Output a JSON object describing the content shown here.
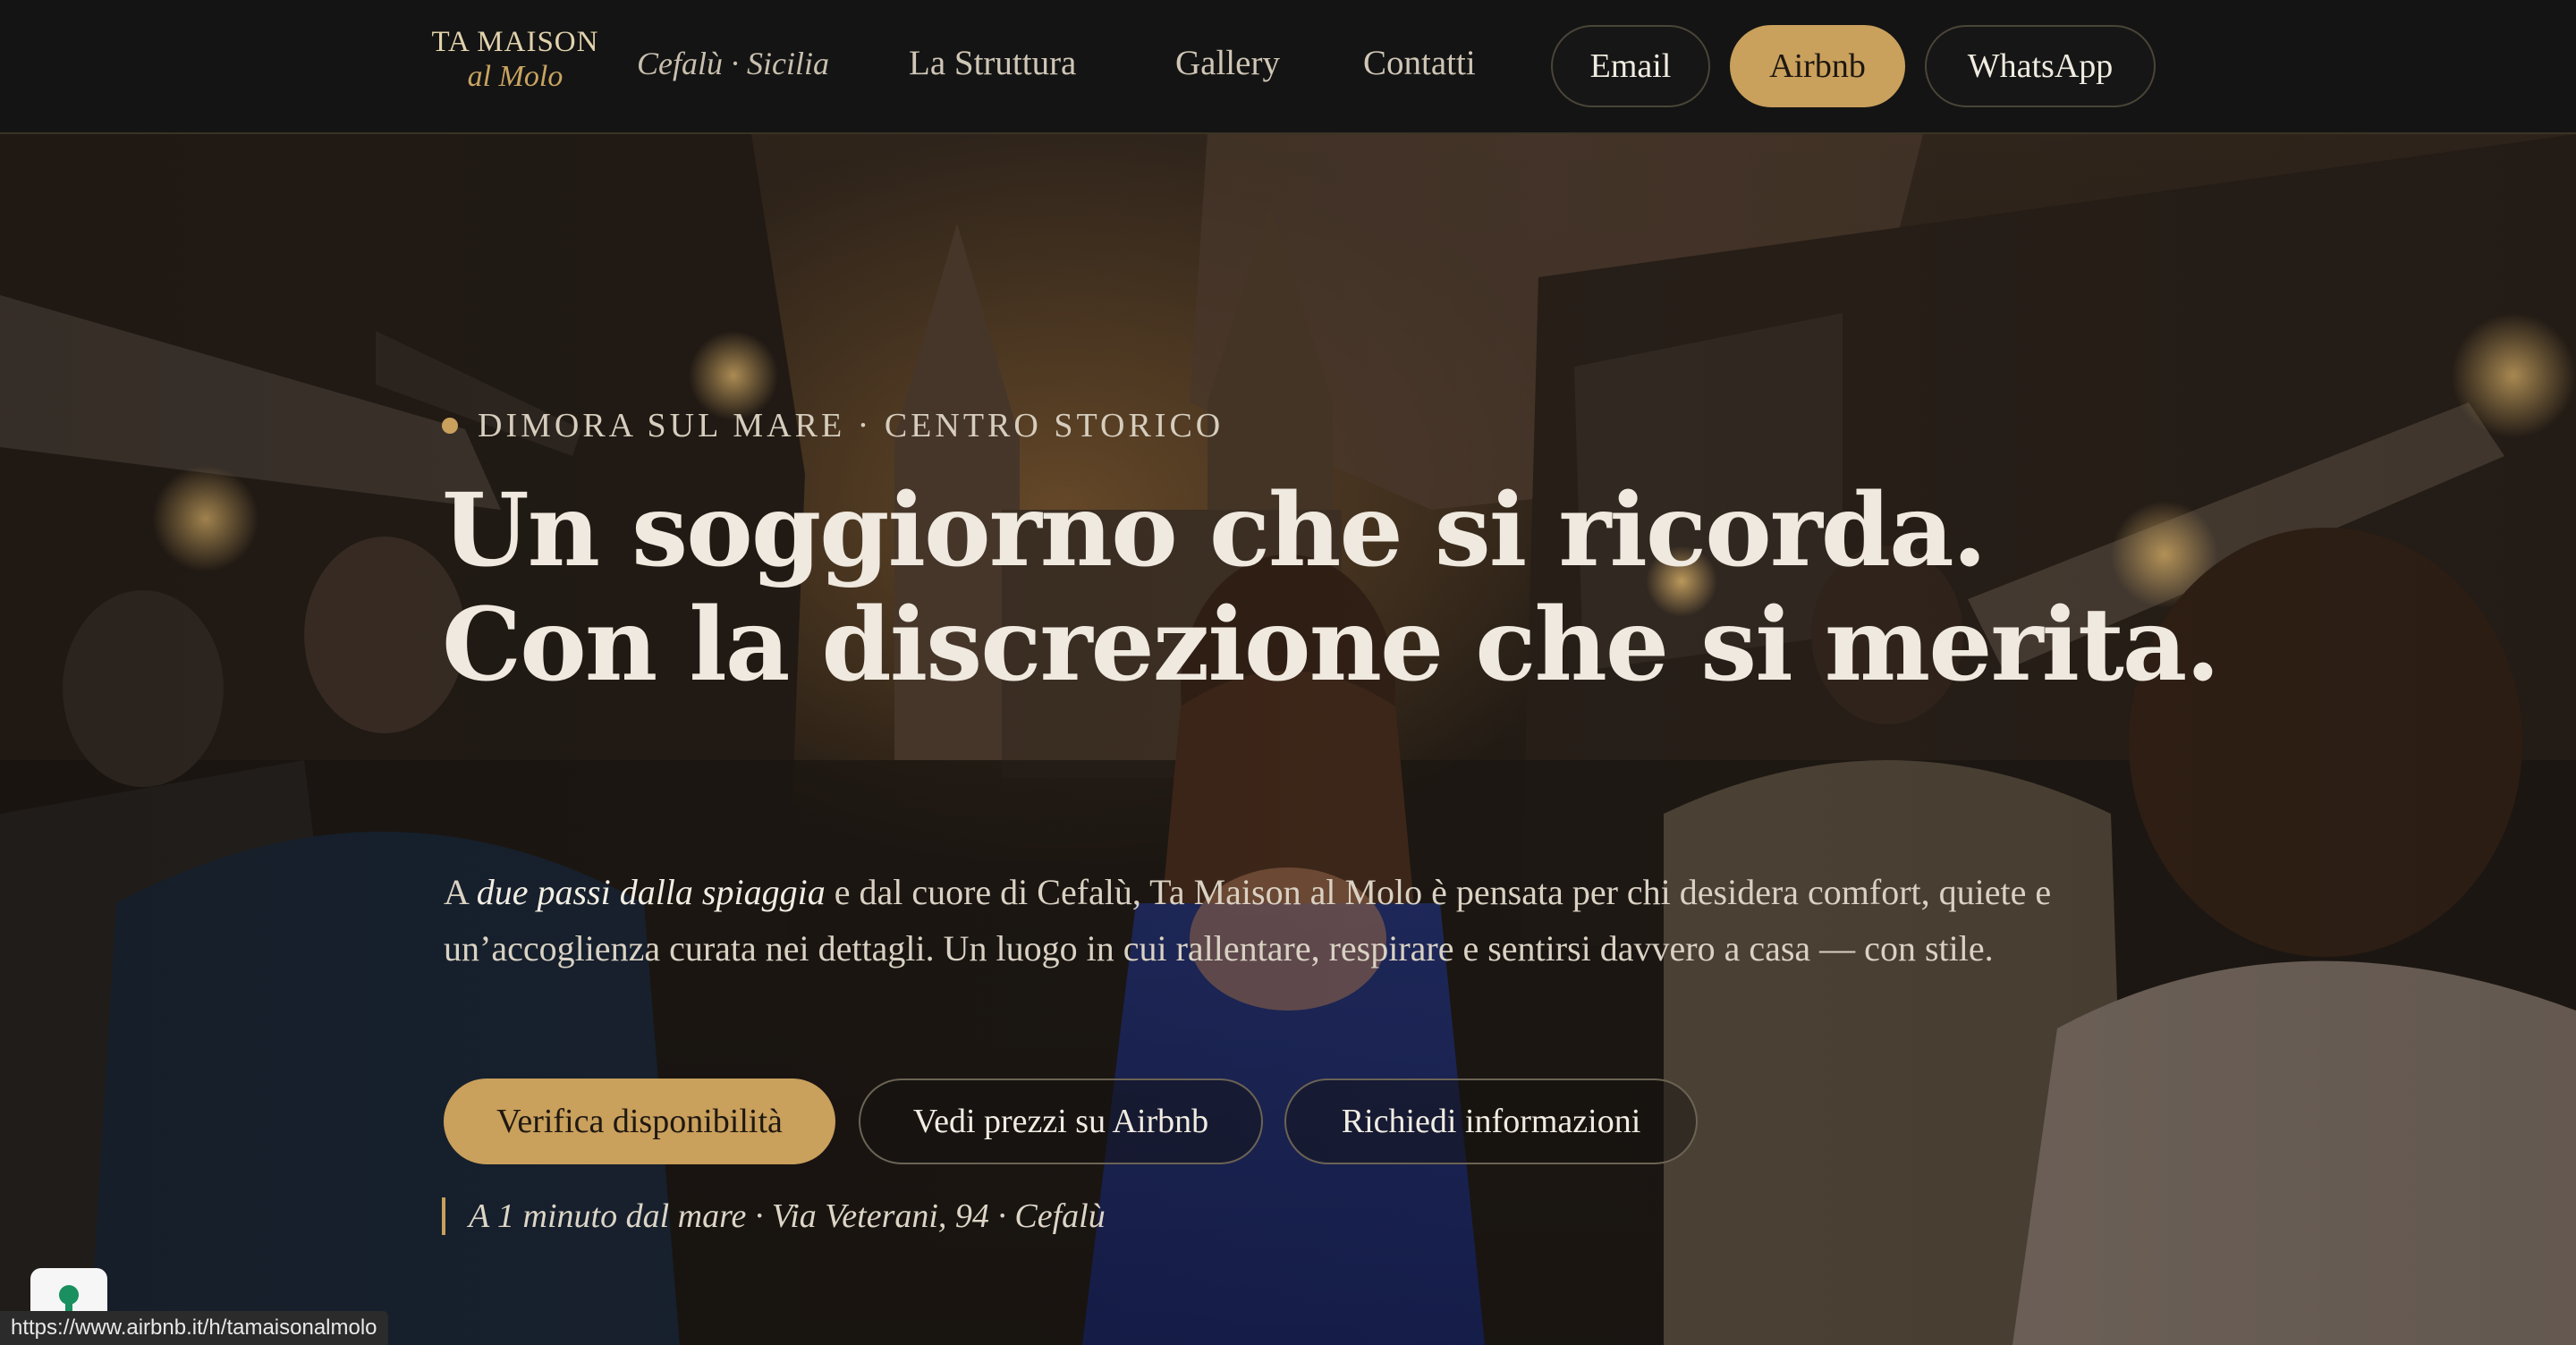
{
  "header": {
    "logo": {
      "main": "TA MAISON",
      "sub": "al Molo"
    },
    "tagline": "Cefalù · Sicilia",
    "nav": [
      {
        "label": "La Struttura"
      },
      {
        "label": "Gallery"
      },
      {
        "label": "Contatti"
      }
    ],
    "pills": {
      "email": "Email",
      "airbnb": "Airbnb",
      "whatsapp": "WhatsApp"
    }
  },
  "hero": {
    "eyebrow": "DIMORA SUL MARE · CENTRO STORICO",
    "headline_line1": "Un soggiorno che si ricorda.",
    "headline_line2": "Con la discrezione che si merita.",
    "lead_prefix": "A ",
    "lead_emphasis": "due passi dalla spiaggia",
    "lead_rest": " e dal cuore di Cefalù, Ta Maison al Molo è pensata per chi desidera comfort, quiete e un’accoglienza curata nei dettagli. Un luogo in cui rallentare, respirare e sentirsi davvero a casa — con stile.",
    "buttons": {
      "availability": "Verifica disponibilità",
      "prices": "Vedi prezzi su Airbnb",
      "info": "Richiedi informazioni"
    },
    "location": "A 1 minuto dal mare · Via Veterani, 94 · Cefalù"
  },
  "status_bar": {
    "url": "https://www.airbnb.it/h/tamaisonalmolo"
  },
  "colors": {
    "gold": "#c9a05c",
    "header_bg": "#141414",
    "text_light": "#efe9df"
  },
  "icons": {
    "chat_widget": "chat-bubble-icon"
  }
}
